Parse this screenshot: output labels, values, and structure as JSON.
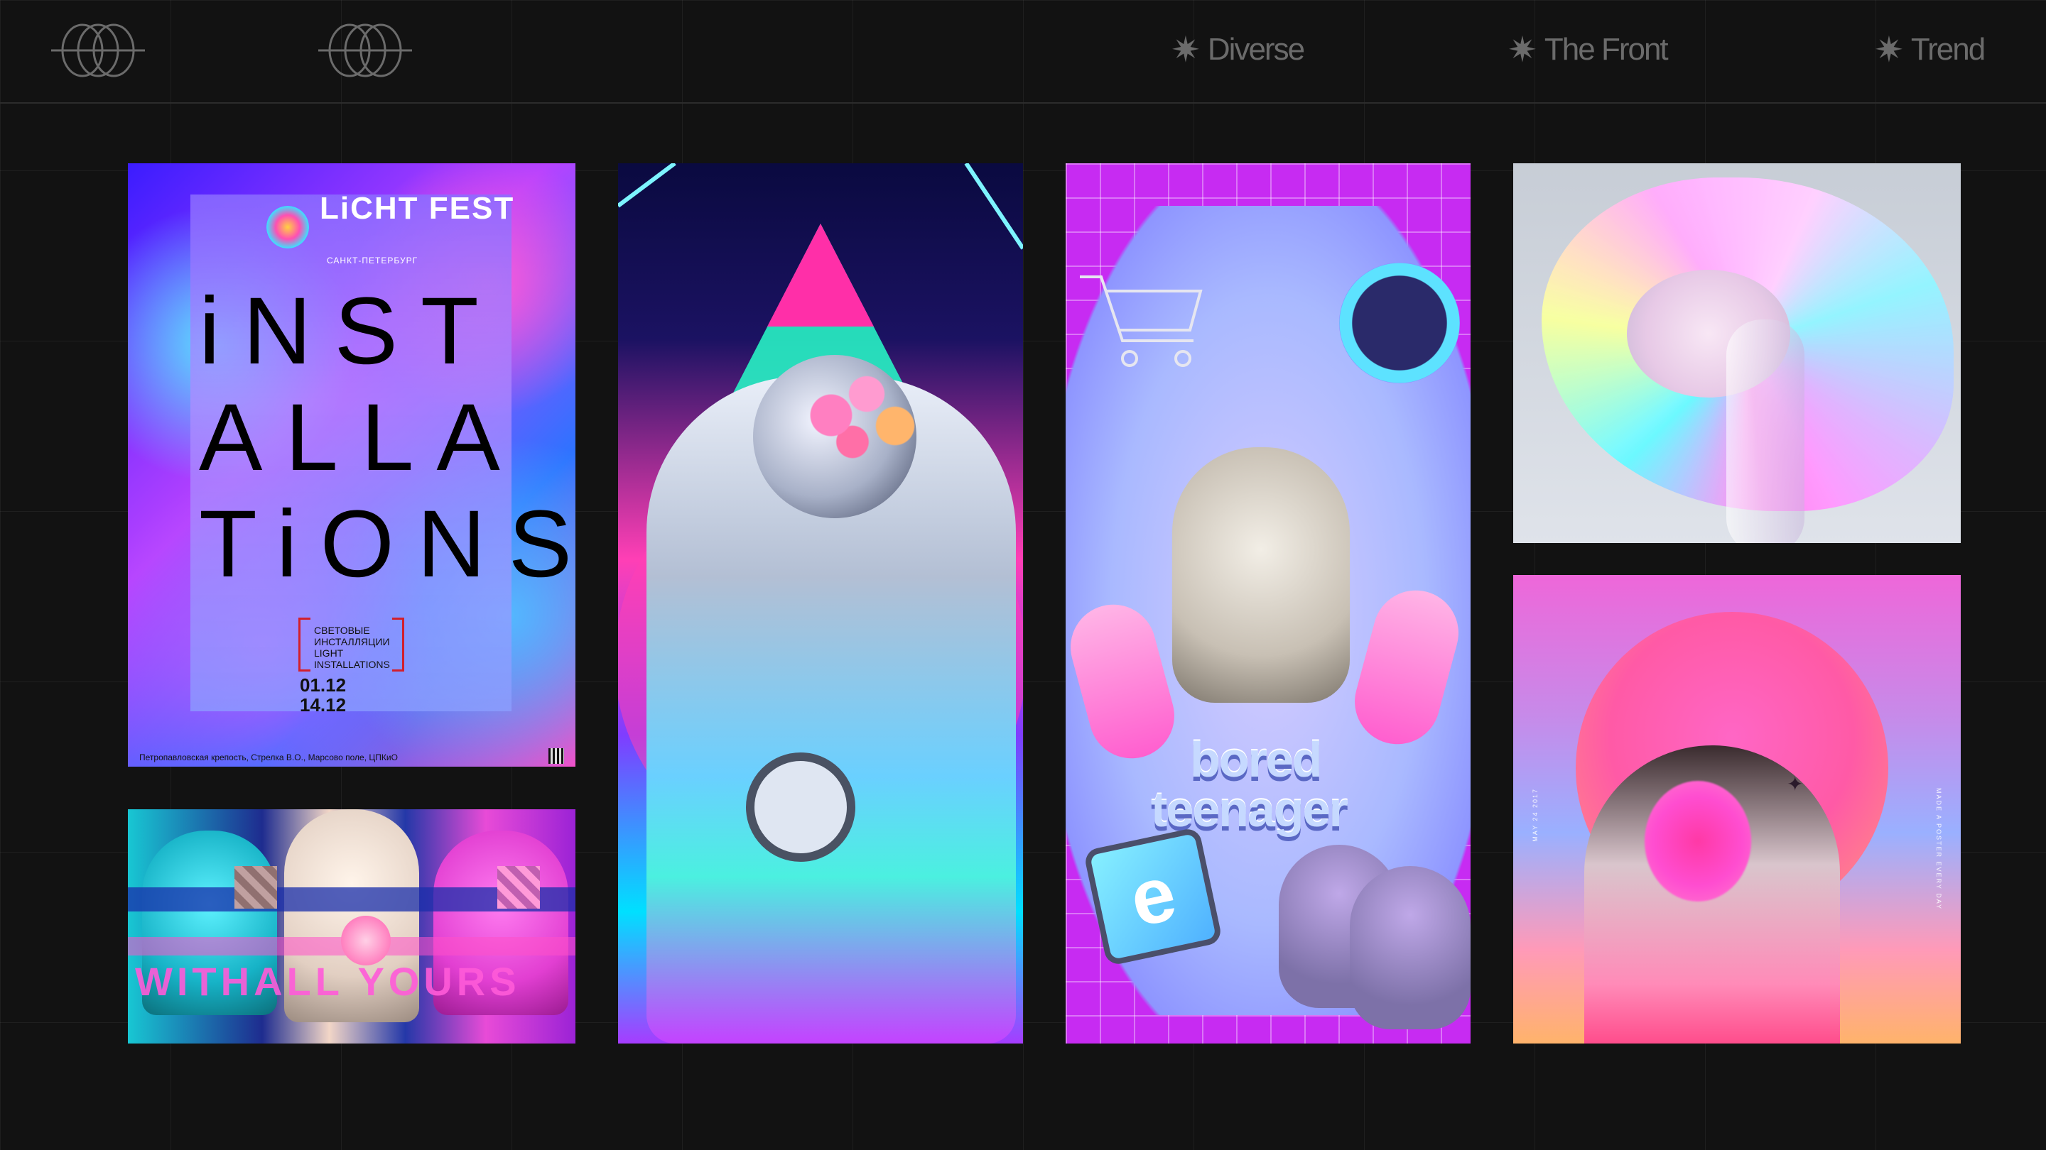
{
  "nav": {
    "items": [
      {
        "label": "Diverse"
      },
      {
        "label": "The Front"
      },
      {
        "label": "Trend"
      }
    ],
    "star_glyph": "✷",
    "logo_icon": "orbit-rings-logo-icon"
  },
  "tiles": {
    "lightfest": {
      "brand": "LiCHT FEST",
      "city": "САНКТ-ПЕТЕРБУРГ",
      "line1": "iNST",
      "line2": "ALLA",
      "line3": "TiONS",
      "desc": "СВЕТОВЫЕ ИНСТАЛЛЯЦИИ LIGHT INSTALLATIONS",
      "date1": "01.12",
      "date2": "14.12",
      "footer": "Петропавловская крепость, Стрелка В.О., Марсово поле, ЦПКиО"
    },
    "teenager": {
      "word1": "bored",
      "word2": "teenager",
      "ie_glyph": "e"
    },
    "glitch": {
      "text": "WITHALL YOURS"
    },
    "poster": {
      "side_left": "MAY 24 2017",
      "side_right": "MADE A POSTER EVERY DAY"
    }
  },
  "colors": {
    "background": "#121212",
    "nav_text": "#6b6b6b",
    "grid_line": "#2c2c2c"
  }
}
